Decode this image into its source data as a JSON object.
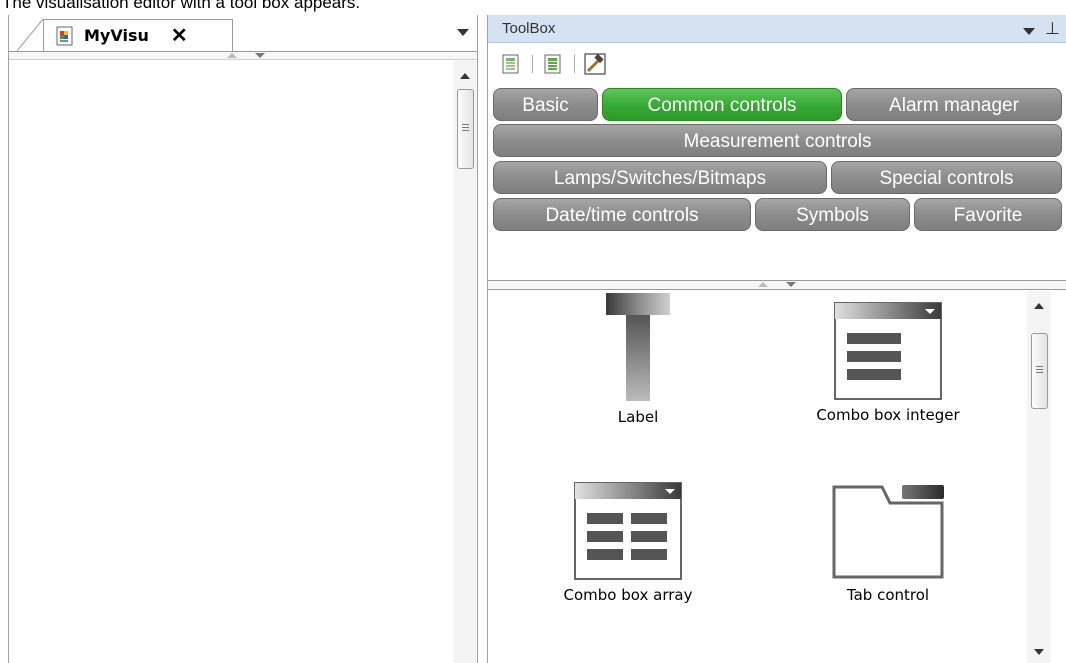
{
  "caption": "The visualisation editor with a tool box appears.",
  "editor": {
    "tab_label": "MyVisu",
    "close_glyph": "✕"
  },
  "toolbox": {
    "title": "ToolBox",
    "pin_glyph": "ᚬ",
    "toolbar_icons": [
      "visu-element-icon",
      "visu-element-icon",
      "hammer-icon"
    ],
    "categories": [
      {
        "label": "Basic",
        "active": false
      },
      {
        "label": "Common controls",
        "active": true
      },
      {
        "label": "Alarm manager",
        "active": false
      },
      {
        "label": "Measurement controls",
        "active": false
      },
      {
        "label": "Lamps/Switches/Bitmaps",
        "active": false
      },
      {
        "label": "Special controls",
        "active": false
      },
      {
        "label": "Date/time controls",
        "active": false
      },
      {
        "label": "Symbols",
        "active": false
      },
      {
        "label": "Favorite",
        "active": false
      }
    ],
    "items": [
      {
        "label": "Label",
        "icon": "label-icon"
      },
      {
        "label": "Combo box integer",
        "icon": "combo-box-integer-icon"
      },
      {
        "label": "Combo box array",
        "icon": "combo-box-array-icon"
      },
      {
        "label": "Tab control",
        "icon": "tab-control-icon"
      }
    ]
  },
  "colors": {
    "active_category": "#37a935",
    "inactive_category": "#8c8c8c",
    "titlebar": "#d5e2f1"
  }
}
